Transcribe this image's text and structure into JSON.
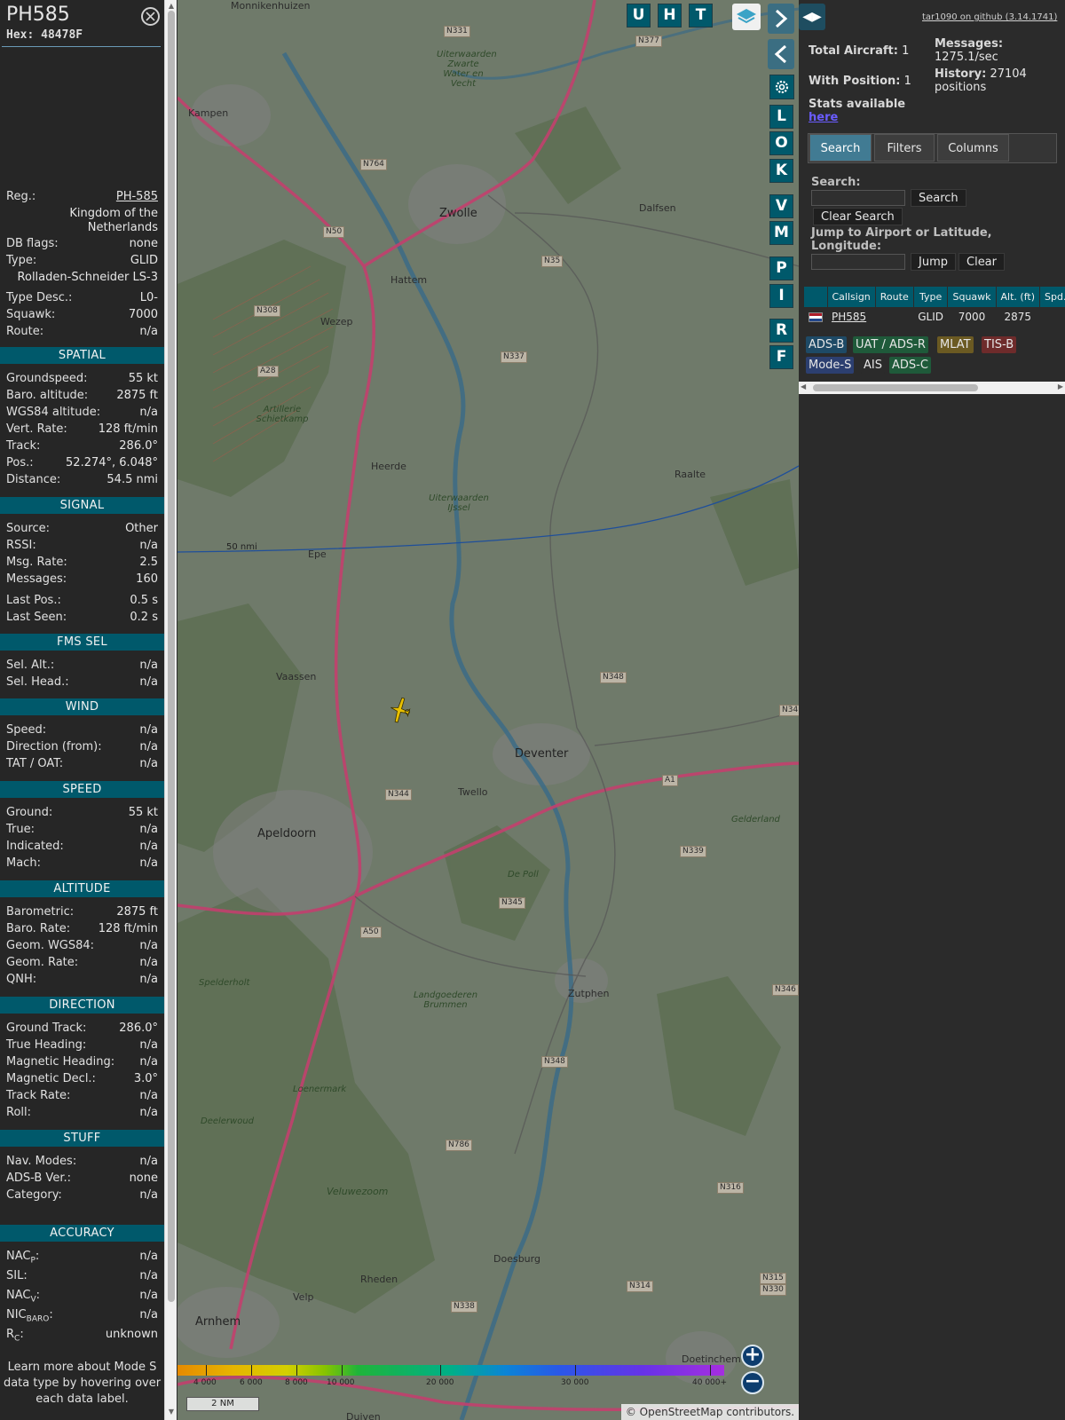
{
  "aircraft": {
    "callsign": "PH585",
    "hex": "Hex:  48478F",
    "reg_label": "Reg.:",
    "reg": "PH-585",
    "country": "Kingdom of the Netherlands",
    "db_flags_label": "DB flags:",
    "db_flags": "none",
    "type_label": "Type:",
    "type": "GLID",
    "type_full": "Rolladen-Schneider LS-3",
    "type_desc_label": "Type Desc.:",
    "type_desc": "L0-",
    "squawk_label": "Squawk:",
    "squawk": "7000",
    "route_label": "Route:",
    "route": "n/a"
  },
  "sections": {
    "spatial": {
      "title": "SPATIAL",
      "rows": [
        {
          "label": "Groundspeed:",
          "value": "55 kt"
        },
        {
          "label": "Baro. altitude:",
          "value": "2875 ft"
        },
        {
          "label": "WGS84 altitude:",
          "value": "n/a"
        },
        {
          "label": "Vert. Rate:",
          "value": "128 ft/min"
        },
        {
          "label": "Track:",
          "value": "286.0°"
        },
        {
          "label": "Pos.:",
          "value": "52.274°, 6.048°"
        },
        {
          "label": "Distance:",
          "value": "54.5 nmi"
        }
      ]
    },
    "signal": {
      "title": "SIGNAL",
      "rows": [
        {
          "label": "Source:",
          "value": "Other"
        },
        {
          "label": "RSSI:",
          "value": "n/a"
        },
        {
          "label": "Msg. Rate:",
          "value": "2.5"
        },
        {
          "label": "Messages:",
          "value": "160"
        },
        {
          "label": "Last Pos.:",
          "value": "0.5 s"
        },
        {
          "label": "Last Seen:",
          "value": "0.2 s"
        }
      ]
    },
    "fms": {
      "title": "FMS SEL",
      "rows": [
        {
          "label": "Sel. Alt.:",
          "value": "n/a"
        },
        {
          "label": "Sel. Head.:",
          "value": "n/a"
        }
      ]
    },
    "wind": {
      "title": "WIND",
      "rows": [
        {
          "label": "Speed:",
          "value": "n/a"
        },
        {
          "label": "Direction (from):",
          "value": "n/a"
        },
        {
          "label": "TAT / OAT:",
          "value": "n/a"
        }
      ]
    },
    "speed": {
      "title": "SPEED",
      "rows": [
        {
          "label": "Ground:",
          "value": "55 kt"
        },
        {
          "label": "True:",
          "value": "n/a"
        },
        {
          "label": "Indicated:",
          "value": "n/a"
        },
        {
          "label": "Mach:",
          "value": "n/a"
        }
      ]
    },
    "altitude": {
      "title": "ALTITUDE",
      "rows": [
        {
          "label": "Barometric:",
          "value": "2875 ft"
        },
        {
          "label": "Baro. Rate:",
          "value": "128 ft/min"
        },
        {
          "label": "Geom. WGS84:",
          "value": "n/a"
        },
        {
          "label": "Geom. Rate:",
          "value": "n/a"
        },
        {
          "label": "QNH:",
          "value": "n/a"
        }
      ]
    },
    "direction": {
      "title": "DIRECTION",
      "rows": [
        {
          "label": "Ground Track:",
          "value": "286.0°"
        },
        {
          "label": "True Heading:",
          "value": "n/a"
        },
        {
          "label": "Magnetic Heading:",
          "value": "n/a"
        },
        {
          "label": "Magnetic Decl.:",
          "value": "3.0°"
        },
        {
          "label": "Track Rate:",
          "value": "n/a"
        },
        {
          "label": "Roll:",
          "value": "n/a"
        }
      ]
    },
    "stuff": {
      "title": "STUFF",
      "rows": [
        {
          "label": "Nav. Modes:",
          "value": "n/a"
        },
        {
          "label": "ADS-B Ver.:",
          "value": "none"
        },
        {
          "label": "Category:",
          "value": "n/a"
        }
      ]
    },
    "accuracy": {
      "title": "ACCURACY",
      "rows": [
        {
          "label": "NAC",
          "sub": "P",
          "value": "n/a"
        },
        {
          "label": "SIL:",
          "sub": "",
          "value": "n/a"
        },
        {
          "label": "NAC",
          "sub": "V",
          "value": "n/a"
        },
        {
          "label": "NIC",
          "sub": "BARO",
          "value": "n/a"
        },
        {
          "label": "R",
          "sub": "C",
          "value": "unknown"
        }
      ]
    }
  },
  "learn_more": "Learn more about Mode S data type by hovering over each data label.",
  "map": {
    "buttons_top": [
      "U",
      "H",
      "T"
    ],
    "buttons_side": [
      "L",
      "O",
      "K",
      "V",
      "M",
      "P",
      "I",
      "R",
      "F"
    ],
    "places": [
      "Kampen",
      "Zwolle",
      "Dalfsen",
      "Hattem",
      "Wezep",
      "Heerde",
      "Raalte",
      "Epe",
      "Vaassen",
      "Deventer",
      "Twello",
      "Apeldoorn",
      "Zutphen",
      "Rheden",
      "Doesburg",
      "Velp",
      "Arnhem",
      "Doetinchem",
      "Duiven",
      "Monnikenhuizen"
    ],
    "green_places": [
      "Artillerie Schietkamp",
      "Uiterwaarden Zwarte Water en Vecht",
      "Uiterwaarden IJssel",
      "Landgoederen Brummen",
      "Spelderholt",
      "Loenermark",
      "Deelerwoud",
      "Veluwezoom",
      "Gelderland",
      "De Poll"
    ],
    "roads": [
      "N331",
      "N377",
      "N764",
      "N50",
      "N35",
      "N308",
      "A28",
      "N337",
      "N348",
      "N344",
      "A1",
      "N339",
      "N345",
      "A50",
      "N346",
      "N786",
      "N316",
      "N314",
      "N315",
      "N330",
      "N338",
      "N34",
      "N348"
    ],
    "range_ring_label": "50 nmi",
    "legend_labels": [
      "4 000",
      "6 000",
      "8 000",
      "10 000",
      "20 000",
      "30 000",
      "40 000+"
    ],
    "scale": "2 NM",
    "attribution": "© OpenStreetMap contributors."
  },
  "side": {
    "github_link": "tar1090 on github (3.14.1741)",
    "total_aircraft_label": "Total Aircraft:",
    "total_aircraft": "1",
    "with_position_label": "With Position:",
    "with_position": "1",
    "messages_label": "Messages:",
    "messages_value": "1275.1/sec",
    "history_label": "History:",
    "history_value": "27104 positions",
    "stats_text": "Stats available",
    "stats_link": "here",
    "tabs": [
      "Search",
      "Filters",
      "Columns"
    ],
    "search_label": "Search:",
    "search_button": "Search",
    "clear_search_button": "Clear Search",
    "jump_label": "Jump to Airport or Latitude, Longitude:",
    "jump_button": "Jump",
    "clear_button": "Clear",
    "table": {
      "headers": [
        "",
        "Callsign",
        "Route",
        "Type",
        "Squawk",
        "Alt. (ft)",
        "Spd."
      ],
      "row": [
        "",
        "PH585",
        "",
        "GLID",
        "7000",
        "2875",
        ""
      ]
    },
    "source_chips": [
      "ADS-B",
      "UAT / ADS-R",
      "MLAT",
      "TIS-B",
      "Mode-S",
      "AIS",
      "ADS-C"
    ],
    "chip_colors": [
      "#1e4a66",
      "#1f5a3a",
      "#6b5a22",
      "#6e2b2b",
      "#2c3f70",
      "#2b2b2b",
      "#1f5a3a"
    ]
  },
  "colors": {
    "section_header": "#00596b",
    "map_base": "#6f7a6a",
    "active_tab": "#417b93",
    "range_ring": "#1f4f9a",
    "highway": "#c2406e",
    "river": "#3c6b86",
    "aircraft": "#e8c000"
  }
}
